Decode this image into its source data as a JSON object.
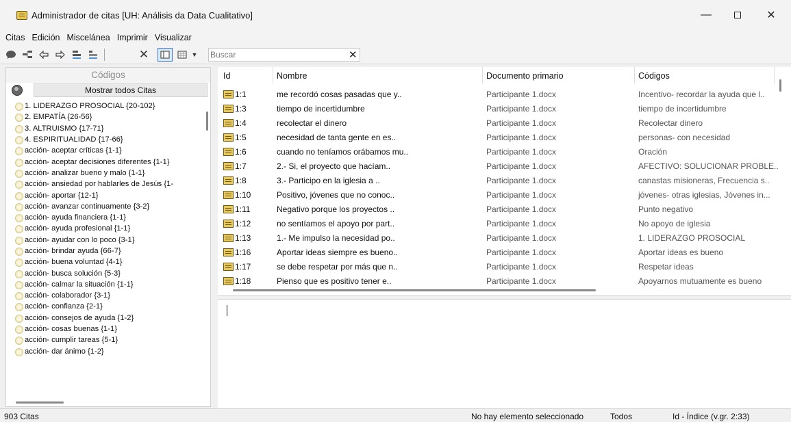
{
  "window": {
    "title": "Administrador de citas [UH: Análisis da Data Cualitativo]",
    "controls": {
      "minimize": "—",
      "maximize": "",
      "close": "✕"
    }
  },
  "menu": [
    "Citas",
    "Edición",
    "Miscelánea",
    "Imprimir",
    "Visualizar"
  ],
  "toolbar": {
    "icons": [
      "speech-bubble-icon",
      "tree-icon",
      "arrow-left-icon",
      "arrow-right-icon",
      "stack-icon",
      "stack-remove-icon",
      "delete-x-icon",
      "panel-icon",
      "grid-icon",
      "dropdown-arrow-icon"
    ],
    "search_placeholder": "Buscar",
    "search_clear": "✕"
  },
  "codes_panel": {
    "header": "Códigos",
    "show_all_button": "Mostrar todos Citas",
    "items": [
      "1. LIDERAZGO PROSOCIAL {20-102}",
      "2. EMPATÍA {26-56}",
      "3. ALTRUISMO {17-71}",
      "4. ESPIRITUALIDAD {17-66}",
      "acción- aceptar críticas {1-1}",
      "acción- aceptar decisiones diferentes {1-1}",
      "acción- analizar bueno y malo {1-1}",
      "acción- ansiedad por hablarles de Jesús {1-",
      "acción- aportar {12-1}",
      "acción- avanzar continuamente {3-2}",
      "acción- ayuda financiera {1-1}",
      "acción- ayuda profesional {1-1}",
      "acción- ayudar con lo poco {3-1}",
      "acción- brindar ayuda {66-7}",
      "acción- buena voluntad {4-1}",
      "acción- busca solución {5-3}",
      "acción- calmar la situación {1-1}",
      "acción- colaborador {3-1}",
      "acción- confianza {2-1}",
      "acción- consejos de ayuda {1-2}",
      "acción- cosas buenas {1-1}",
      "acción- cumplir tareas {5-1}",
      "acción- dar ánimo {1-2}"
    ]
  },
  "quotes_table": {
    "columns": [
      "Id",
      "Nombre",
      "Documento primario",
      "Códigos"
    ],
    "rows": [
      {
        "id": "1:1",
        "name": "me recordó cosas pasadas que y..",
        "doc": "Participante 1.docx",
        "codes": "Incentivo- recordar la ayuda que l.."
      },
      {
        "id": "1:3",
        "name": "tiempo de incertidumbre",
        "doc": "Participante 1.docx",
        "codes": "tiempo de incertidumbre"
      },
      {
        "id": "1:4",
        "name": "recolectar el dinero",
        "doc": "Participante 1.docx",
        "codes": "Recolectar dinero"
      },
      {
        "id": "1:5",
        "name": "necesidad de tanta gente en es..",
        "doc": "Participante 1.docx",
        "codes": "personas- con necesidad"
      },
      {
        "id": "1:6",
        "name": "cuando no teníamos orábamos mu..",
        "doc": "Participante 1.docx",
        "codes": "Oración"
      },
      {
        "id": "1:7",
        "name": "2.- Si, el proyecto que hacíam..",
        "doc": "Participante 1.docx",
        "codes": "AFECTIVO: SOLUCIONAR PROBLE.."
      },
      {
        "id": "1:8",
        "name": "3.- Participo en la iglesia a ..",
        "doc": "Participante 1.docx",
        "codes": "canastas misioneras, Frecuencia s.."
      },
      {
        "id": "1:10",
        "name": "Positivo, jóvenes que no conoc..",
        "doc": "Participante 1.docx",
        "codes": "jóvenes- otras iglesias, Jóvenes in..."
      },
      {
        "id": "1:11",
        "name": "Negativo porque los proyectos ..",
        "doc": "Participante 1.docx",
        "codes": "Punto negativo"
      },
      {
        "id": "1:12",
        "name": "no sentíamos el apoyo por part..",
        "doc": "Participante 1.docx",
        "codes": "No apoyo de iglesia"
      },
      {
        "id": "1:13",
        "name": "1.- Me impulso la necesidad po..",
        "doc": "Participante 1.docx",
        "codes": "1. LIDERAZGO PROSOCIAL"
      },
      {
        "id": "1:16",
        "name": "Aportar ideas siempre es bueno..",
        "doc": "Participante 1.docx",
        "codes": "Aportar ideas es bueno"
      },
      {
        "id": "1:17",
        "name": "se debe respetar por más que n..",
        "doc": "Participante 1.docx",
        "codes": "Respetar ideas"
      },
      {
        "id": "1:18",
        "name": "Pienso que es positivo tener e..",
        "doc": "Participante 1.docx",
        "codes": "Apoyarnos mutuamente es bueno"
      }
    ]
  },
  "status": {
    "count": "903 Citas",
    "selection": "No hay elemento seleccionado",
    "filter": "Todos",
    "sort": "Id - Índice (v.gr. 2:33)"
  }
}
